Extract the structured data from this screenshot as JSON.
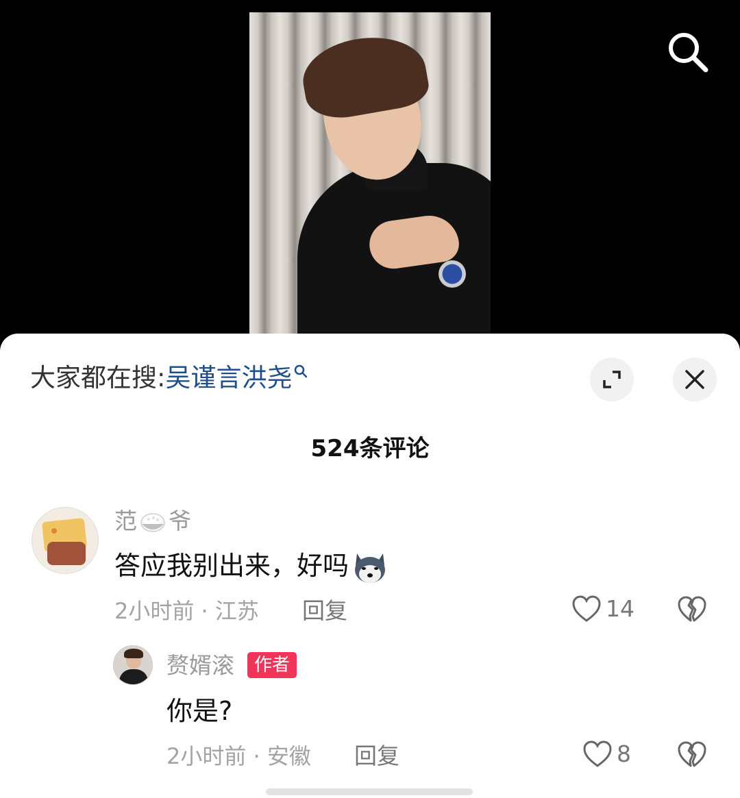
{
  "header": {
    "trending_prefix": "大家都在搜:",
    "trending_query": "吴谨言洪尧"
  },
  "comments_count": "524条评论",
  "comments": [
    {
      "user_start": "范",
      "user_end": "爷",
      "text": "答应我别出来，好吗",
      "meta": "2小时前 · 江苏",
      "reply": "回复",
      "likes": "14"
    }
  ],
  "reply_comment": {
    "user": "赘婿滚",
    "badge": "作者",
    "text": "你是?",
    "meta": "2小时前 · 安徽",
    "reply": "回复",
    "likes": "8"
  },
  "icons": {
    "search": "search-icon",
    "expand": "expand-icon",
    "close": "close-icon",
    "like": "heart-icon",
    "dislike": "broken-heart-icon"
  },
  "colors": {
    "link": "#1f4e8c",
    "badge": "#f0345a",
    "muted": "#a3a3a3"
  }
}
